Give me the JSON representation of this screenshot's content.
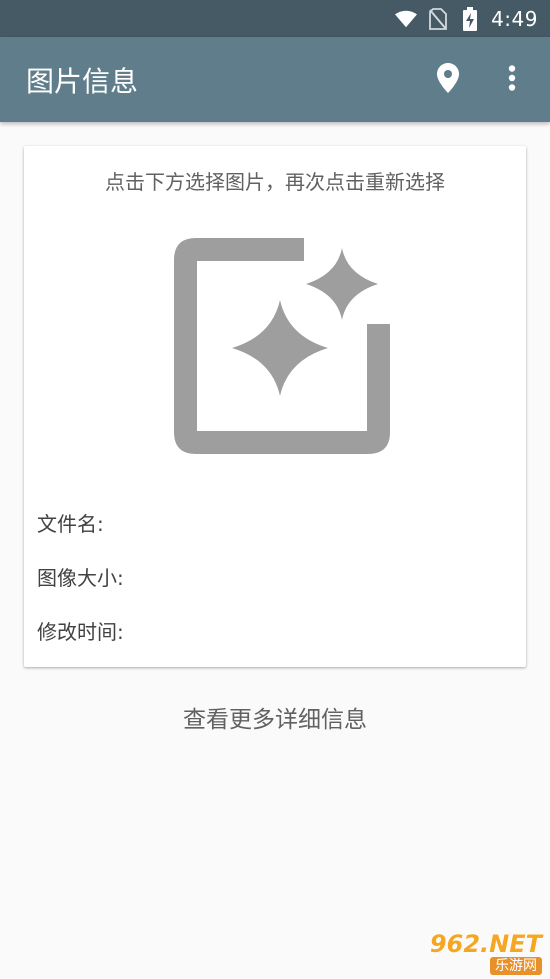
{
  "status_bar": {
    "time": "4:49",
    "icons": [
      "wifi-icon",
      "no-sim-icon",
      "battery-charging-icon"
    ]
  },
  "app_bar": {
    "title": "图片信息",
    "actions": [
      "location-pin-icon",
      "more-vert-icon"
    ]
  },
  "card": {
    "hint": "点击下方选择图片，再次点击重新选择",
    "picker_icon": "add-photo-sparkle-icon",
    "info": {
      "file_name_label": "文件名:",
      "image_size_label": "图像大小:",
      "modified_time_label": "修改时间:"
    }
  },
  "more_details_label": "查看更多详细信息",
  "watermark": {
    "top": "962.NET",
    "bottom": "乐游网"
  },
  "colors": {
    "status_bar": "#455a64",
    "app_bar": "#607d8b",
    "background": "#fafafa",
    "icon_gray": "#9e9e9e"
  }
}
